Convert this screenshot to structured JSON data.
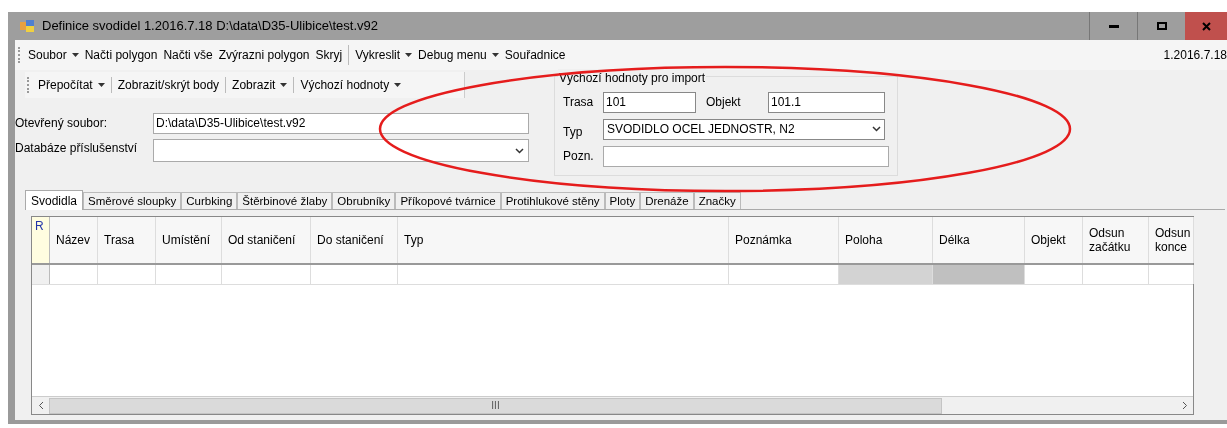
{
  "window": {
    "title": "Definice svodidel 1.2016.7.18 D:\\data\\D35-Ulibice\\test.v92"
  },
  "menu": [
    {
      "label": "Soubor",
      "dropdown": true,
      "separator_before": false
    },
    {
      "label": "Načti polygon",
      "dropdown": false,
      "separator_before": false
    },
    {
      "label": "Načti vše",
      "dropdown": false,
      "separator_before": false
    },
    {
      "label": "Zvýrazni polygon",
      "dropdown": false,
      "separator_before": false
    },
    {
      "label": "Skryj",
      "dropdown": false,
      "separator_before": false
    },
    {
      "label": "Vykreslit",
      "dropdown": true,
      "separator_before": true
    },
    {
      "label": "Debug menu",
      "dropdown": true,
      "separator_before": false
    },
    {
      "label": "Souřadnice",
      "dropdown": false,
      "separator_before": false
    }
  ],
  "version": "1.2016.7.18",
  "toolbar": [
    {
      "label": "Přepočítat",
      "dropdown": true
    },
    {
      "label": "Zobrazit/skrýt body",
      "dropdown": false
    },
    {
      "label": "Zobrazit",
      "dropdown": true
    },
    {
      "label": "Výchozí hodnoty",
      "dropdown": true
    }
  ],
  "open_file": {
    "label": "Otevřený soubor:",
    "value": "D:\\data\\D35-Ulibice\\test.v92"
  },
  "accessories_db": {
    "label": "Databáze příslušenství"
  },
  "import_defaults": {
    "title": "Výchozí hodnoty pro import",
    "trasa_label": "Trasa",
    "trasa": "101",
    "objekt_label": "Objekt",
    "objekt": "101.1",
    "typ_label": "Typ",
    "typ": "SVODIDLO OCEL JEDNOSTR, N2",
    "pozn_label": "Pozn."
  },
  "tabs": [
    {
      "label": "Svodidla",
      "selected": true
    },
    {
      "label": "Směrové sloupky",
      "selected": false
    },
    {
      "label": "Curbking",
      "selected": false
    },
    {
      "label": "Štěrbinové žlaby",
      "selected": false
    },
    {
      "label": "Obrubníky",
      "selected": false
    },
    {
      "label": "Příkopové tvárnice",
      "selected": false
    },
    {
      "label": "Protihlukové stěny",
      "selected": false
    },
    {
      "label": "Ploty",
      "selected": false
    },
    {
      "label": "Drenáže",
      "selected": false
    },
    {
      "label": "Značky",
      "selected": false
    }
  ],
  "grid": {
    "corner": "R",
    "columns": [
      {
        "label": "Název",
        "readonly": false
      },
      {
        "label": "Trasa",
        "readonly": false
      },
      {
        "label": "Umístění",
        "readonly": false
      },
      {
        "label": "Od staničení",
        "readonly": false
      },
      {
        "label": "Do staničení",
        "readonly": false
      },
      {
        "label": "Typ",
        "readonly": false
      },
      {
        "label": "Poznámka",
        "readonly": false
      },
      {
        "label": "Poloha",
        "readonly": true
      },
      {
        "label": "Délka",
        "readonly": true
      },
      {
        "label": "Objekt",
        "readonly": false
      },
      {
        "label": "Odsun začátku",
        "readonly": false
      },
      {
        "label": "Odsun konce",
        "readonly": false
      }
    ],
    "scroll_thumb": "III"
  }
}
